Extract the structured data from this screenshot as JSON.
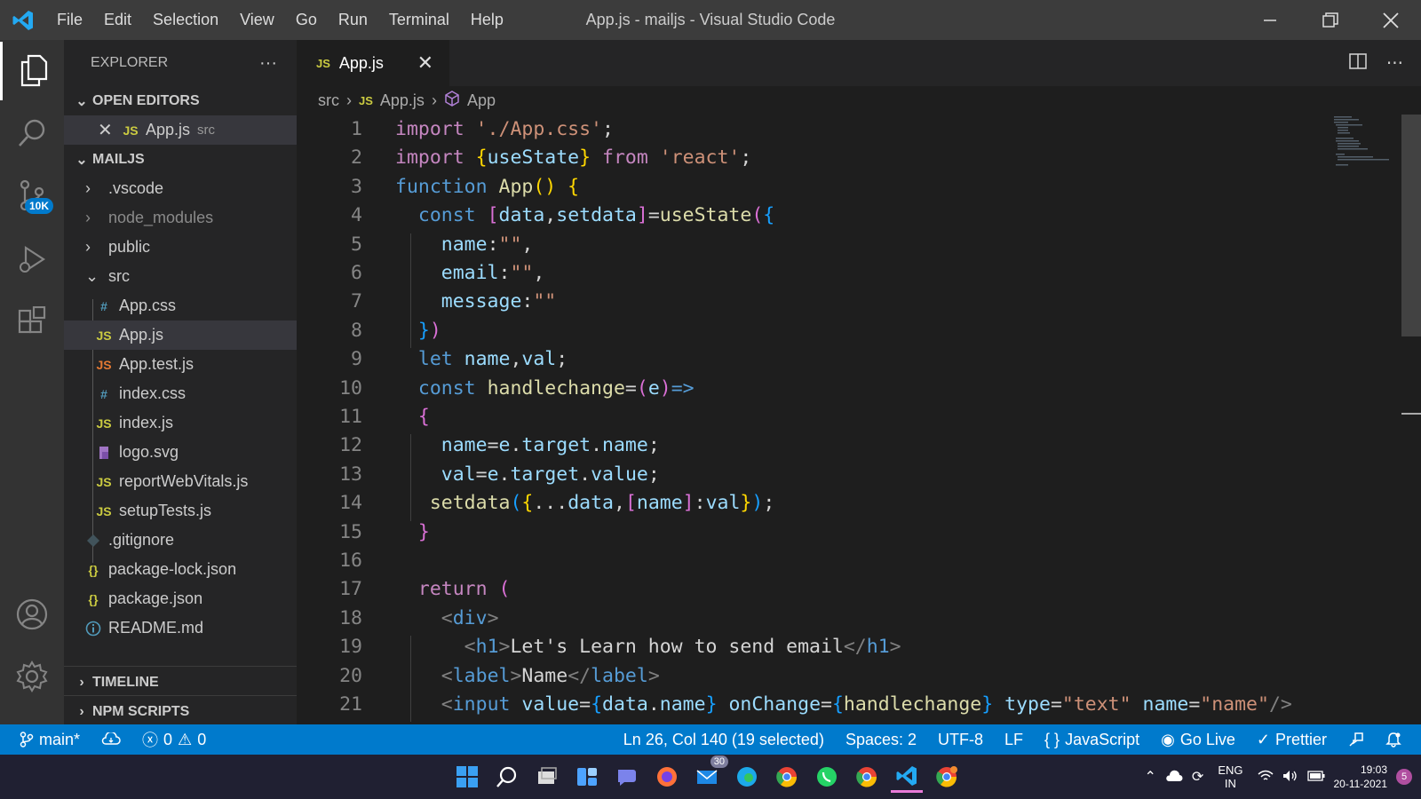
{
  "titlebar": {
    "title": "App.js - mailjs - Visual Studio Code",
    "menu": [
      "File",
      "Edit",
      "Selection",
      "View",
      "Go",
      "Run",
      "Terminal",
      "Help"
    ]
  },
  "activity": {
    "badge": "10K"
  },
  "sidebar": {
    "title": "EXPLORER",
    "open_editors_label": "OPEN EDITORS",
    "open_editor": {
      "name": "App.js",
      "hint": "src",
      "icon": "JS"
    },
    "project_label": "MAILJS",
    "folders": [
      ".vscode",
      "node_modules",
      "public",
      "src"
    ],
    "src_files": [
      {
        "icon": "#",
        "name": "App.css"
      },
      {
        "icon": "JS",
        "name": "App.js"
      },
      {
        "icon": "JS",
        "name": "App.test.js"
      },
      {
        "icon": "#",
        "name": "index.css"
      },
      {
        "icon": "JS",
        "name": "index.js"
      },
      {
        "icon": "svg-icon",
        "name": "logo.svg"
      },
      {
        "icon": "JS",
        "name": "reportWebVitals.js"
      },
      {
        "icon": "JS",
        "name": "setupTests.js"
      }
    ],
    "root_files": [
      {
        "icon": "git-icon",
        "name": ".gitignore"
      },
      {
        "icon": "{}",
        "name": "package-lock.json"
      },
      {
        "icon": "{}",
        "name": "package.json"
      },
      {
        "icon": "info-icon",
        "name": "README.md"
      }
    ],
    "timeline_label": "TIMELINE",
    "npm_label": "NPM SCRIPTS"
  },
  "editor": {
    "tab": {
      "icon": "JS",
      "name": "App.js"
    },
    "breadcrumb": [
      "src",
      "App.js",
      "App"
    ],
    "line_numbers": [
      "1",
      "2",
      "3",
      "4",
      "5",
      "6",
      "7",
      "8",
      "9",
      "10",
      "11",
      "12",
      "13",
      "14",
      "15",
      "16",
      "17",
      "18",
      "19",
      "20",
      "21"
    ],
    "lines": [
      [
        [
          "kc",
          "import "
        ],
        [
          "st",
          "'./App.css'"
        ],
        [
          "tx",
          ";"
        ]
      ],
      [
        [
          "kc",
          "import "
        ],
        [
          "by",
          "{"
        ],
        [
          "vr",
          "useState"
        ],
        [
          "by",
          "}"
        ],
        [
          "kc",
          " from "
        ],
        [
          "st",
          "'react'"
        ],
        [
          "tx",
          ";"
        ]
      ],
      [
        [
          "kw",
          "function "
        ],
        [
          "fn",
          "App"
        ],
        [
          "by",
          "() {"
        ]
      ],
      [
        [
          "tx",
          "  "
        ],
        [
          "kw",
          "const "
        ],
        [
          "bp",
          "["
        ],
        [
          "vr",
          "data"
        ],
        [
          "tx",
          ","
        ],
        [
          "vr",
          "setdata"
        ],
        [
          "bp",
          "]"
        ],
        [
          "tx",
          "="
        ],
        [
          "fn",
          "useState"
        ],
        [
          "bp",
          "("
        ],
        [
          "bb",
          "{"
        ]
      ],
      [
        [
          "tx",
          "    "
        ],
        [
          "vr",
          "name"
        ],
        [
          "tx",
          ":"
        ],
        [
          "st",
          "\"\""
        ],
        [
          "tx",
          ","
        ]
      ],
      [
        [
          "tx",
          "    "
        ],
        [
          "vr",
          "email"
        ],
        [
          "tx",
          ":"
        ],
        [
          "st",
          "\"\""
        ],
        [
          "tx",
          ","
        ]
      ],
      [
        [
          "tx",
          "    "
        ],
        [
          "vr",
          "message"
        ],
        [
          "tx",
          ":"
        ],
        [
          "st",
          "\"\""
        ]
      ],
      [
        [
          "tx",
          "  "
        ],
        [
          "bb",
          "}"
        ],
        [
          "bp",
          ")"
        ]
      ],
      [
        [
          "tx",
          "  "
        ],
        [
          "kw",
          "let "
        ],
        [
          "vr",
          "name"
        ],
        [
          "tx",
          ","
        ],
        [
          "vr",
          "val"
        ],
        [
          "tx",
          ";"
        ]
      ],
      [
        [
          "tx",
          "  "
        ],
        [
          "kw",
          "const "
        ],
        [
          "fn",
          "handlechange"
        ],
        [
          "tx",
          "="
        ],
        [
          "bp",
          "("
        ],
        [
          "vr",
          "e"
        ],
        [
          "bp",
          ")"
        ],
        [
          "kw",
          "=>"
        ]
      ],
      [
        [
          "tx",
          "  "
        ],
        [
          "bp",
          "{"
        ]
      ],
      [
        [
          "tx",
          "    "
        ],
        [
          "vr",
          "name"
        ],
        [
          "tx",
          "="
        ],
        [
          "vr",
          "e"
        ],
        [
          "tx",
          "."
        ],
        [
          "vr",
          "target"
        ],
        [
          "tx",
          "."
        ],
        [
          "vr",
          "name"
        ],
        [
          "tx",
          ";"
        ]
      ],
      [
        [
          "tx",
          "    "
        ],
        [
          "vr",
          "val"
        ],
        [
          "tx",
          "="
        ],
        [
          "vr",
          "e"
        ],
        [
          "tx",
          "."
        ],
        [
          "vr",
          "target"
        ],
        [
          "tx",
          "."
        ],
        [
          "vr",
          "value"
        ],
        [
          "tx",
          ";"
        ]
      ],
      [
        [
          "tx",
          "   "
        ],
        [
          "fn",
          "setdata"
        ],
        [
          "bb",
          "("
        ],
        [
          "by",
          "{"
        ],
        [
          "tx",
          "..."
        ],
        [
          "vr",
          "data"
        ],
        [
          "tx",
          ","
        ],
        [
          "bp",
          "["
        ],
        [
          "vr",
          "name"
        ],
        [
          "bp",
          "]"
        ],
        [
          "tx",
          ":"
        ],
        [
          "vr",
          "val"
        ],
        [
          "by",
          "}"
        ],
        [
          "bb",
          ")"
        ],
        [
          "tx",
          ";"
        ]
      ],
      [
        [
          "tx",
          "  "
        ],
        [
          "bp",
          "}"
        ]
      ],
      [
        [
          "tx",
          ""
        ]
      ],
      [
        [
          "tx",
          "  "
        ],
        [
          "kc",
          "return "
        ],
        [
          "bp",
          "("
        ]
      ],
      [
        [
          "tx",
          "    "
        ],
        [
          "tgb",
          "<"
        ],
        [
          "tg",
          "div"
        ],
        [
          "tgb",
          ">"
        ]
      ],
      [
        [
          "tx",
          "      "
        ],
        [
          "tgb",
          "<"
        ],
        [
          "tg",
          "h1"
        ],
        [
          "tgb",
          ">"
        ],
        [
          "tx",
          "Let's Learn how to send email"
        ],
        [
          "tgb",
          "</"
        ],
        [
          "tg",
          "h1"
        ],
        [
          "tgb",
          ">"
        ]
      ],
      [
        [
          "tx",
          "    "
        ],
        [
          "tgb",
          "<"
        ],
        [
          "tg",
          "label"
        ],
        [
          "tgb",
          ">"
        ],
        [
          "tx",
          "Name"
        ],
        [
          "tgb",
          "</"
        ],
        [
          "tg",
          "label"
        ],
        [
          "tgb",
          ">"
        ]
      ],
      [
        [
          "tx",
          "    "
        ],
        [
          "tgb",
          "<"
        ],
        [
          "tg",
          "input "
        ],
        [
          "vr",
          "value"
        ],
        [
          "tx",
          "="
        ],
        [
          "bb",
          "{"
        ],
        [
          "vr",
          "data"
        ],
        [
          "tx",
          "."
        ],
        [
          "vr",
          "name"
        ],
        [
          "bb",
          "}"
        ],
        [
          "vr",
          " onChange"
        ],
        [
          "tx",
          "="
        ],
        [
          "bb",
          "{"
        ],
        [
          "fn",
          "handlechange"
        ],
        [
          "bb",
          "}"
        ],
        [
          "vr",
          " type"
        ],
        [
          "tx",
          "="
        ],
        [
          "st",
          "\"text\""
        ],
        [
          "vr",
          " name"
        ],
        [
          "tx",
          "="
        ],
        [
          "st",
          "\"name\""
        ],
        [
          "tgb",
          "/>"
        ]
      ]
    ]
  },
  "status": {
    "branch": "main*",
    "errors": "0",
    "warnings": "0",
    "position": "Ln 26, Col 140 (19 selected)",
    "spaces": "Spaces: 2",
    "encoding": "UTF-8",
    "eol": "LF",
    "language": "JavaScript",
    "golive": "Go Live",
    "prettier": "Prettier"
  },
  "taskbar": {
    "mail_badge": "30",
    "lang": "ENG",
    "region": "IN",
    "time": "19:03",
    "date": "20-11-2021",
    "notif": "5"
  },
  "colors": {
    "accent": "#007acc",
    "titlebar": "#3c3c3c",
    "sidebar": "#252526",
    "editor": "#1e1e1e"
  }
}
